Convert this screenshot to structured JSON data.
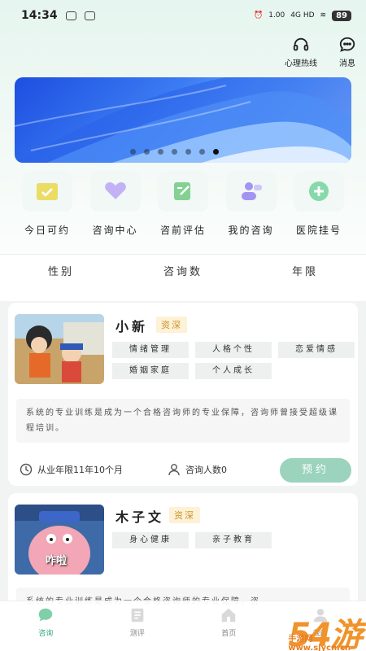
{
  "status": {
    "time": "14:34",
    "network": "4G HD",
    "speed": "1.00",
    "battery": "89"
  },
  "header": {
    "hotline_label": "心理热线",
    "message_label": "消息"
  },
  "banner": {
    "dots_count": 7,
    "active_dot": 6
  },
  "quick_actions": [
    {
      "label": "今日可约",
      "icon": "calendar-check-icon",
      "color": "#e9d95c"
    },
    {
      "label": "咨询中心",
      "icon": "heart-icon",
      "color": "#b9a7f2"
    },
    {
      "label": "咨前评估",
      "icon": "edit-doc-icon",
      "color": "#7fcf8e"
    },
    {
      "label": "我的咨询",
      "icon": "user-chat-icon",
      "color": "#9d8cf0"
    },
    {
      "label": "医院挂号",
      "icon": "plus-icon",
      "color": "#7fd6a4"
    }
  ],
  "filters": [
    "性别",
    "咨询数",
    "年限"
  ],
  "counselors": [
    {
      "name": "小新",
      "badge": "资深",
      "tags": [
        "情绪管理",
        "人格个性",
        "恋爱情感",
        "婚姻家庭",
        "个人成长"
      ],
      "description": "系统的专业训练是成为一个合格咨询师的专业保障，咨询师曾接受超级课程培训。",
      "experience": "从业年限11年10个月",
      "consult_count": "咨询人数0",
      "book_label": "预约"
    },
    {
      "name": "木子文",
      "badge": "资深",
      "tags": [
        "身心健康",
        "亲子教育"
      ],
      "description": "系统的专业训练是成为一个合格咨询师的专业保障，咨",
      "avatar_caption": "咋啦"
    }
  ],
  "tabs": [
    {
      "label": "咨询",
      "icon": "chat-icon",
      "active": true
    },
    {
      "label": "测评",
      "icon": "test-icon",
      "active": false
    },
    {
      "label": "首页",
      "icon": "home-icon",
      "active": false
    },
    {
      "label": "我的",
      "icon": "user-icon",
      "active": false
    }
  ],
  "watermark": {
    "big": "54游",
    "small": "手游网 www.sjycn.cn"
  },
  "colors": {
    "accent": "#3aa57c",
    "button": "#9bd3bd",
    "badge_bg": "#fdf1d6",
    "badge_text": "#c9942f"
  }
}
